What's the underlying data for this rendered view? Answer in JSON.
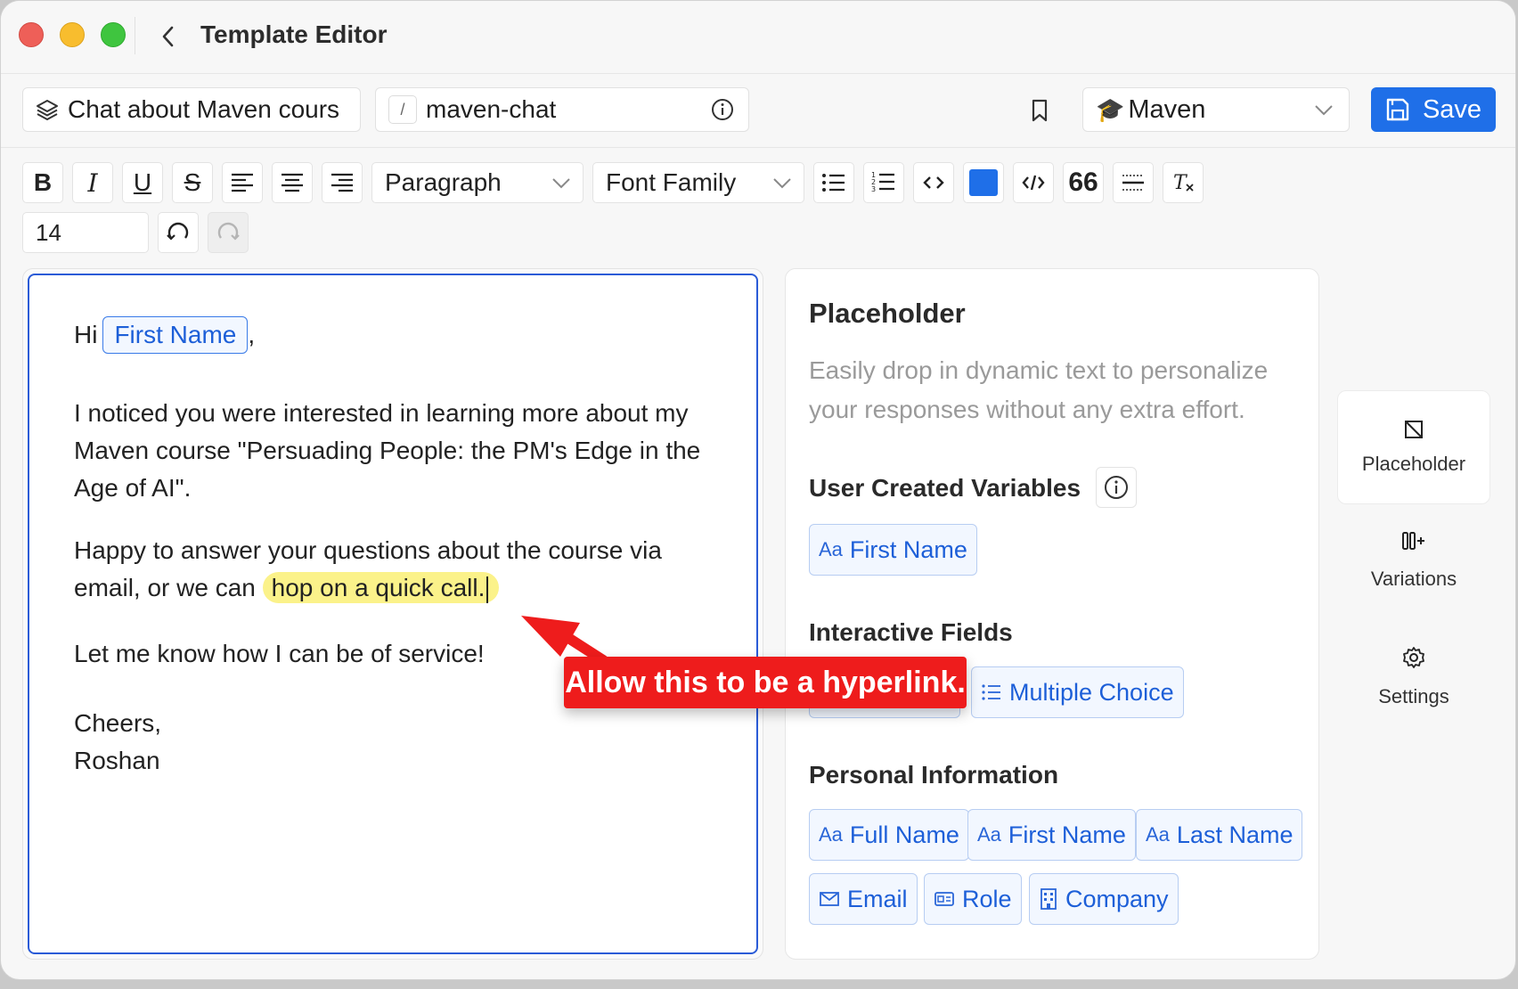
{
  "window": {
    "title": "Template Editor"
  },
  "top": {
    "template_name": "Chat about Maven cours",
    "slug_prefix": "/",
    "slug": "maven-chat",
    "brand": "Maven",
    "brand_icon": "graduation-cap-icon",
    "save_label": "Save"
  },
  "toolbar": {
    "bold": "B",
    "italic": "I",
    "underline": "U",
    "strike": "S",
    "block_type": "Paragraph",
    "font_family": "Font Family",
    "quote": "66",
    "font_size": "14",
    "text_color": "#1f6fe8"
  },
  "editor": {
    "greeting": "Hi",
    "greeting_var": "First Name",
    "greeting_end": ",",
    "para1": "I noticed you were interested in learning more about my Maven course \"Persuading People: the PM's Edge in the Age of AI\".",
    "para2_start": "Happy to answer your questions about the course via email, or we can",
    "para2_highlight": "hop on a quick call.",
    "para3": "Let me know how I can be of service!",
    "signoff": "Cheers,",
    "signature": "Roshan"
  },
  "panel": {
    "title": "Placeholder",
    "description": "Easily drop in dynamic text to personalize your responses without any extra effort.",
    "user_vars_title": "User Created Variables",
    "user_vars": [
      {
        "icon": "Aa",
        "label": "First Name"
      }
    ],
    "interactive_title": "Interactive Fields",
    "interactive": [
      {
        "icon": "list-icon",
        "label": "Multiple Choice"
      }
    ],
    "personal_title": "Personal Information",
    "personal": [
      {
        "icon": "Aa",
        "label": "Full Name"
      },
      {
        "icon": "Aa",
        "label": "First Name"
      },
      {
        "icon": "Aa",
        "label": "Last Name"
      },
      {
        "icon": "mail-icon",
        "label": "Email"
      },
      {
        "icon": "id-card-icon",
        "label": "Role"
      },
      {
        "icon": "building-icon",
        "label": "Company"
      }
    ]
  },
  "rail": {
    "placeholder": "Placeholder",
    "variations": "Variations",
    "settings": "Settings"
  },
  "annotation": {
    "text": "Allow this to be a hyperlink.",
    "color": "#ee1c1c"
  }
}
